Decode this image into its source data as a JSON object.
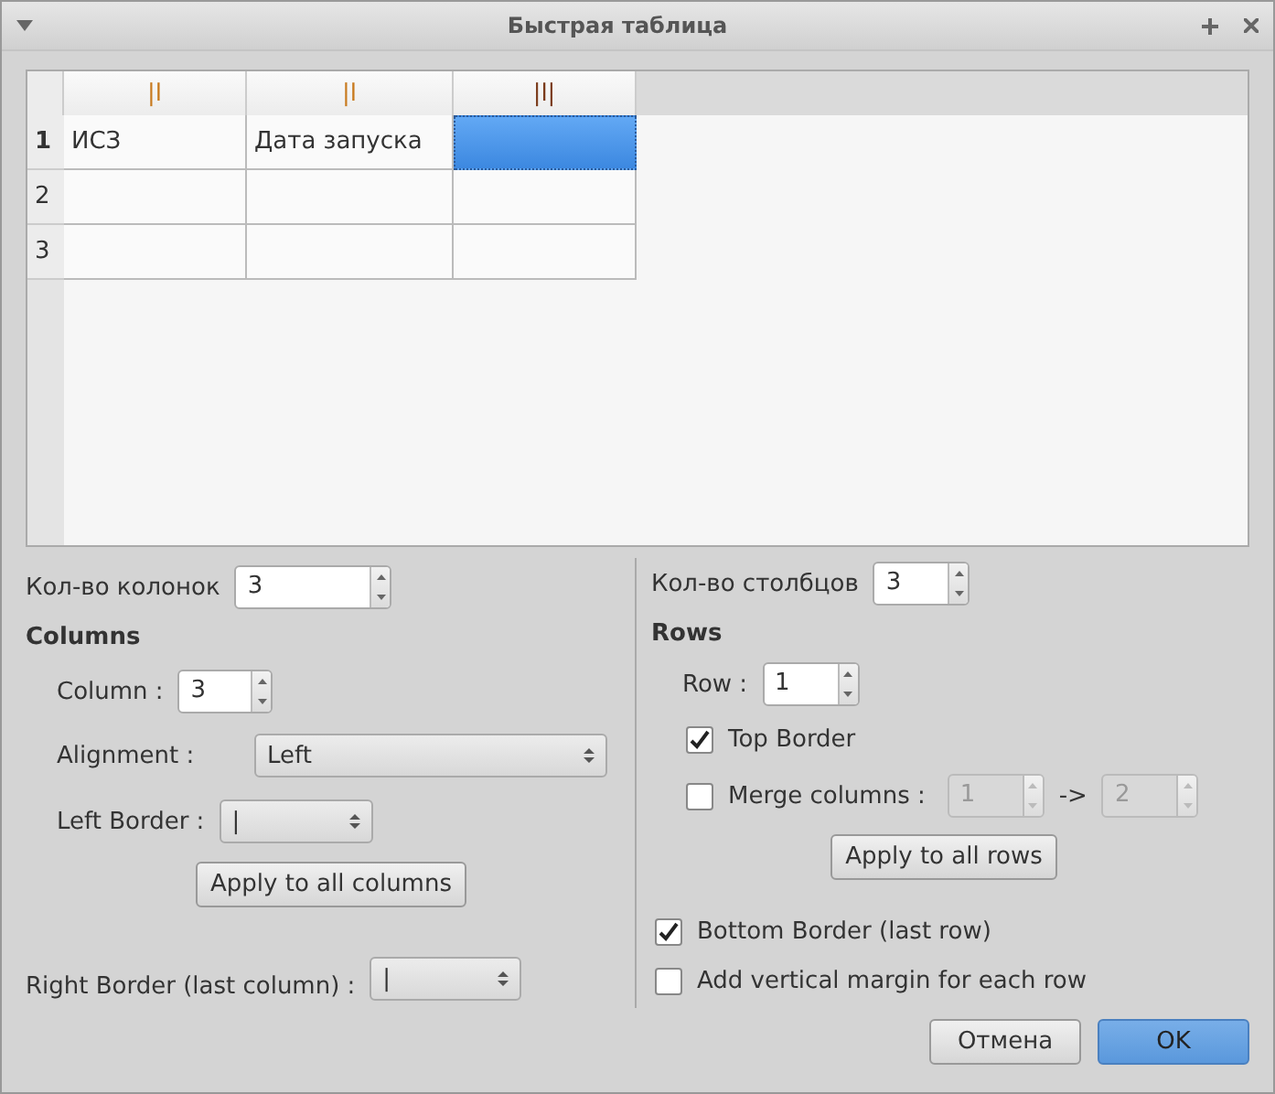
{
  "window": {
    "title": "Быстрая таблица"
  },
  "table": {
    "columns": [
      {
        "label": "|l",
        "color": "#c87a1e"
      },
      {
        "label": "|l",
        "color": "#c87a1e"
      },
      {
        "label": "|l|",
        "color": "#7a3a1a"
      }
    ],
    "rows": [
      {
        "header": "1",
        "current": true,
        "cells": [
          {
            "text": "ИСЗ",
            "selected": false
          },
          {
            "text": "Дата запуска",
            "selected": false
          },
          {
            "text": "",
            "selected": true
          }
        ]
      },
      {
        "header": "2",
        "current": false,
        "cells": [
          {
            "text": "",
            "selected": false
          },
          {
            "text": "",
            "selected": false
          },
          {
            "text": "",
            "selected": false
          }
        ]
      },
      {
        "header": "3",
        "current": false,
        "cells": [
          {
            "text": "",
            "selected": false
          },
          {
            "text": "",
            "selected": false
          },
          {
            "text": "",
            "selected": false
          }
        ]
      }
    ]
  },
  "columns_panel": {
    "count_label": "Кол-во колонок",
    "count": "3",
    "heading": "Columns",
    "column_label": "Column :",
    "column": "3",
    "alignment_label": "Alignment :",
    "alignment": "Left",
    "left_border_label": "Left Border :",
    "left_border": "|",
    "apply": "Apply to all columns",
    "right_border_label": "Right Border (last column) :",
    "right_border": "|"
  },
  "rows_panel": {
    "count_label": "Кол-во столбцов",
    "count": "3",
    "heading": "Rows",
    "row_label": "Row :",
    "row": "1",
    "top_border": {
      "label": "Top Border",
      "checked": true
    },
    "merge": {
      "label": "Merge columns :",
      "checked": false,
      "from": "1",
      "arrow": "->",
      "to": "2",
      "disabled": true
    },
    "apply": "Apply to all rows",
    "bottom_border": {
      "label": "Bottom Border (last row)",
      "checked": true
    },
    "vertical_margin": {
      "label": "Add vertical margin for each row",
      "checked": false
    }
  },
  "buttons": [
    {
      "label": "Отмена",
      "default": false
    },
    {
      "label": "OK",
      "default": true
    }
  ]
}
